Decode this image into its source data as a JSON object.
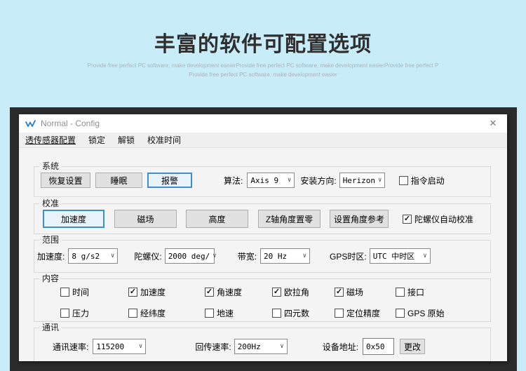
{
  "hero": {
    "title": "丰富的软件可配置选项",
    "subtitle1": "Provide free perfect PC software, make development easierProvide free perfect PC software, make development easierProvide free perfect P",
    "subtitle2": "Provide free perfect PC software, make development easier"
  },
  "ui": {
    "chevron": "∨",
    "close_icon": "✕",
    "check_icon": "✓"
  },
  "window": {
    "title": "Normal - Config"
  },
  "menu": {
    "items": [
      "透传感器配置",
      "锁定",
      "解锁",
      "校准时间"
    ]
  },
  "system": {
    "legend": "系统",
    "restore_button": "恢复设置",
    "sleep_button": "睡眠",
    "alarm_button": "报警",
    "algorithm_label": "算法:",
    "algorithm_value": "Axis 9",
    "install_label": "安装方向:",
    "install_value": "Herizon",
    "cmd_start_label": "指令启动",
    "cmd_start_checked": false
  },
  "calibration": {
    "legend": "校准",
    "acc_button": "加速度",
    "mag_button": "磁场",
    "height_button": "高度",
    "zaxis_zero_button": "Z轴角度置零",
    "angle_ref_button": "设置角度参考",
    "gyro_auto_label": "陀螺仪自动校准",
    "gyro_auto_checked": true
  },
  "range": {
    "legend": "范围",
    "acc_label": "加速度:",
    "acc_value": "8  g/s2",
    "gyro_label": "陀螺仪:",
    "gyro_value": "2000 deg/",
    "bandwidth_label": "带宽:",
    "bandwidth_value": "20  Hz",
    "gps_label": "GPS时区:",
    "gps_value": "UTC 中时区"
  },
  "content": {
    "legend": "内容",
    "row1": [
      {
        "label": "时间",
        "checked": false
      },
      {
        "label": "加速度",
        "checked": true
      },
      {
        "label": "角速度",
        "checked": true
      },
      {
        "label": "欧拉角",
        "checked": true
      },
      {
        "label": "磁场",
        "checked": true
      },
      {
        "label": "接口",
        "checked": false
      }
    ],
    "row2": [
      {
        "label": "压力",
        "checked": false
      },
      {
        "label": "经纬度",
        "checked": false
      },
      {
        "label": "地速",
        "checked": false
      },
      {
        "label": "四元数",
        "checked": false
      },
      {
        "label": "定位精度",
        "checked": false
      },
      {
        "label": "GPS 原始",
        "checked": false
      }
    ]
  },
  "comm": {
    "legend": "通讯",
    "baud_label": "通讯速率:",
    "baud_value": "115200",
    "rate_label": "回传速率:",
    "rate_value": "200Hz",
    "addr_label": "设备地址:",
    "addr_value": "0x50",
    "change_button": "更改"
  },
  "colors": {
    "accent_blue": "#3c8fd6",
    "page_bg": "#c9ecf9",
    "frame": "#2b2b2b"
  }
}
